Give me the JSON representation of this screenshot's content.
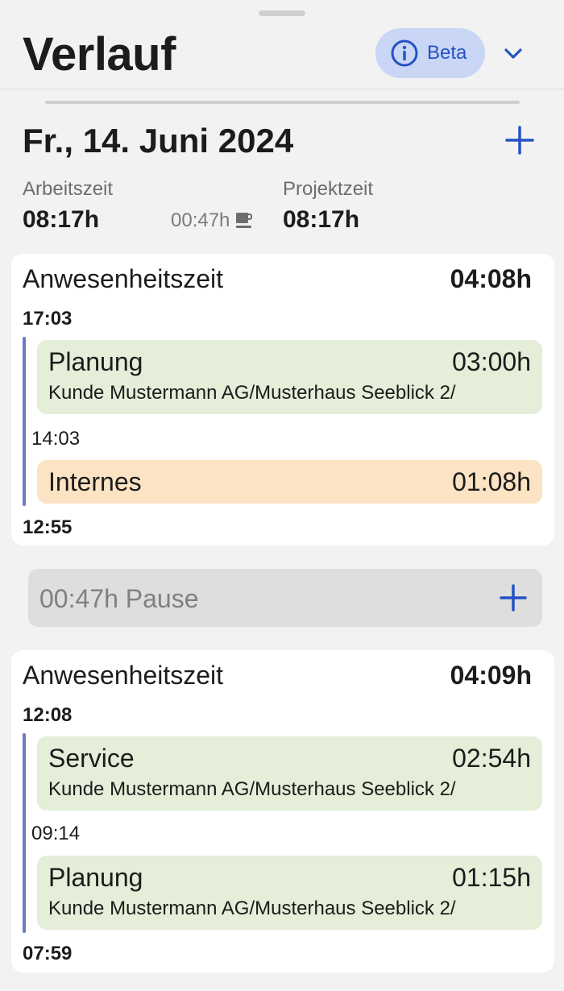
{
  "header": {
    "title": "Verlauf",
    "beta_label": "Beta",
    "beta_icon": "info-icon",
    "menu_icon": "chevron-down-icon"
  },
  "day": {
    "date": "Fr., 14. Juni 2024",
    "add_icon": "plus-icon",
    "arbeitszeit_label": "Arbeitszeit",
    "arbeitszeit_value": "08:17h",
    "pause_value": "00:47h",
    "pause_icon": "coffee-icon",
    "projektzeit_label": "Projektzeit",
    "projektzeit_value": "08:17h"
  },
  "blocks": [
    {
      "title": "Anwesenheitszeit",
      "total": "04:08h",
      "start": "17:03",
      "end": "12:55",
      "entries": [
        {
          "name": "Planung",
          "duration": "03:00h",
          "subtitle": "Kunde Mustermann AG/Musterhaus Seeblick 2/",
          "color": "#e4eed8"
        },
        {
          "boundary": "14:03"
        },
        {
          "name": "Internes",
          "duration": "01:08h",
          "subtitle": "",
          "color": "#fbe3c3"
        }
      ]
    },
    {
      "title": "Anwesenheitszeit",
      "total": "04:09h",
      "start": "12:08",
      "end": "07:59",
      "entries": [
        {
          "name": "Service",
          "duration": "02:54h",
          "subtitle": "Kunde Mustermann AG/Musterhaus Seeblick 2/",
          "color": "#e4eed8"
        },
        {
          "boundary": "09:14"
        },
        {
          "name": "Planung",
          "duration": "01:15h",
          "subtitle": "Kunde Mustermann AG/Musterhaus Seeblick 2/",
          "color": "#e4eed8"
        }
      ]
    }
  ],
  "pause": {
    "label": "00:47h Pause",
    "add_icon": "plus-icon"
  },
  "colors": {
    "accent": "#2452c4",
    "timeline": "#6f79c8",
    "beta_bg": "#c9d6f5"
  }
}
